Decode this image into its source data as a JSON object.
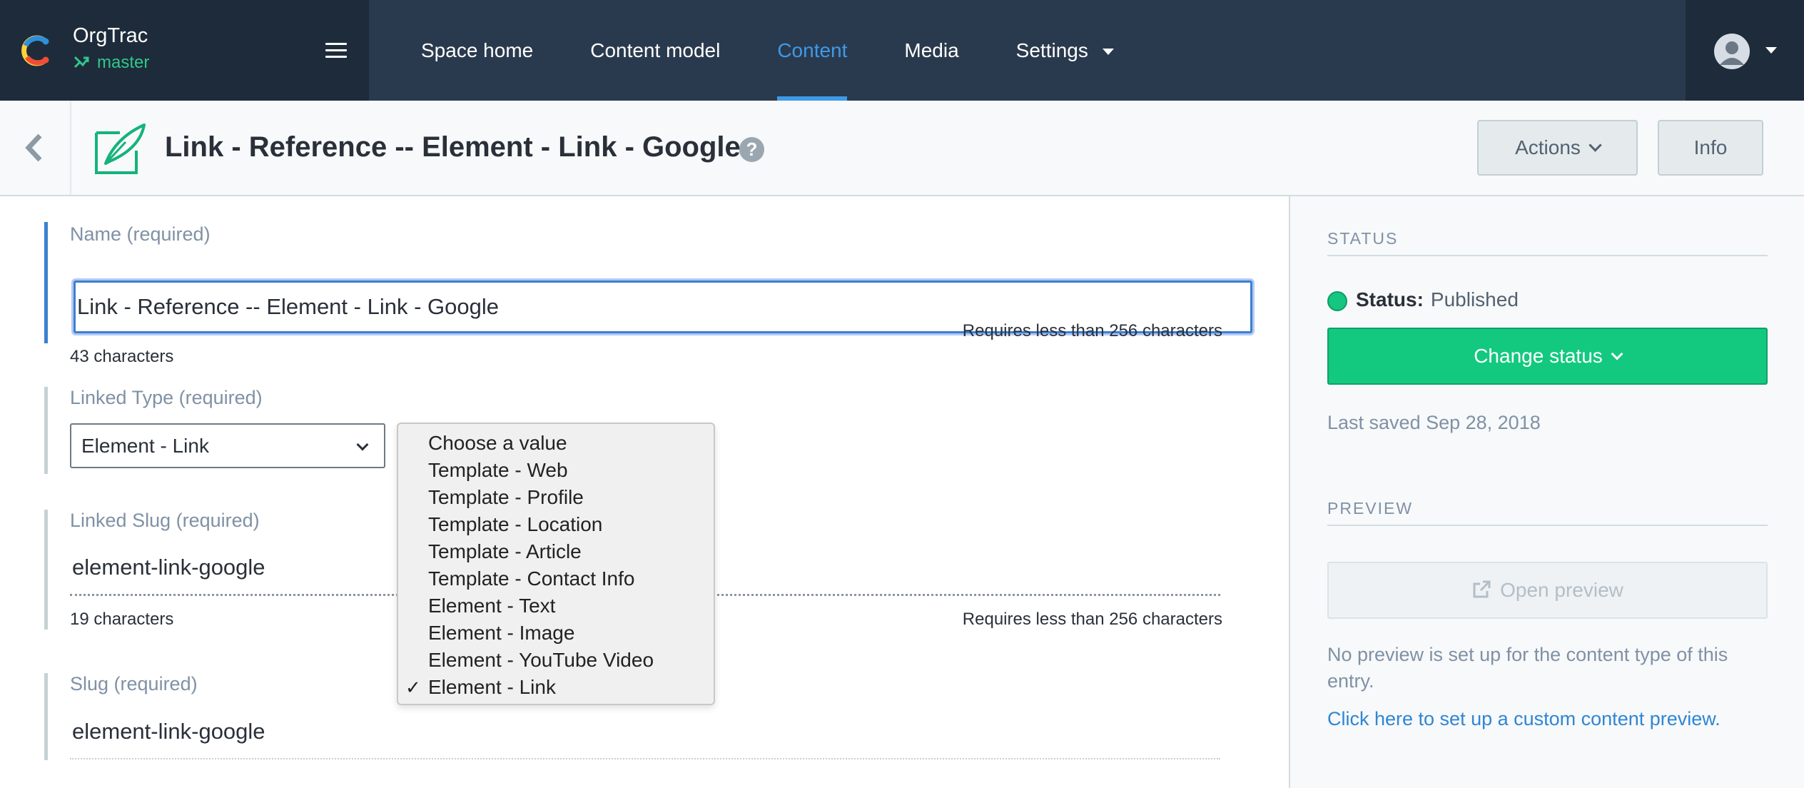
{
  "nav": {
    "space_name": "OrgTrac",
    "environment": "master",
    "items": [
      {
        "label": "Space home"
      },
      {
        "label": "Content model"
      },
      {
        "label": "Content"
      },
      {
        "label": "Media"
      },
      {
        "label": "Settings"
      }
    ],
    "active_item": "Content"
  },
  "entry": {
    "title": "Link - Reference -- Element - Link - Google",
    "help_symbol": "?",
    "actions_label": "Actions",
    "info_label": "Info"
  },
  "fields": {
    "name": {
      "label": "Name (required)",
      "value": "Link - Reference -- Element - Link - Google",
      "count": "43 characters",
      "limit": "Requires less than 256 characters"
    },
    "linked_type": {
      "label": "Linked Type (required)",
      "selected": "Element - Link",
      "options": [
        "Choose a value",
        "Template - Web",
        "Template - Profile",
        "Template - Location",
        "Template - Article",
        "Template - Contact Info",
        "Element - Text",
        "Element - Image",
        "Element - YouTube Video",
        "Element - Link"
      ]
    },
    "linked_slug": {
      "label": "Linked Slug (required)",
      "value": "element-link-google",
      "count": "19 characters",
      "limit": "Requires less than 256 characters"
    },
    "slug": {
      "label": "Slug (required)",
      "value": "element-link-google"
    }
  },
  "sidebar": {
    "status_heading": "STATUS",
    "status_label": "Status:",
    "status_value": "Published",
    "change_status_label": "Change status",
    "last_saved": "Last saved Sep 28, 2018",
    "preview_heading": "PREVIEW",
    "open_preview_label": "Open preview",
    "no_preview_text": "No preview is set up for the content type of this entry.",
    "custom_preview_link": "Click here to set up a custom content preview."
  },
  "colors": {
    "nav_bg": "#2a3a4e",
    "nav_dark": "#1e2b3a",
    "accent_blue": "#3d9ae8",
    "status_green": "#14c67f",
    "link_blue": "#2f86d4"
  },
  "icons": [
    "contentful-logo",
    "branch-icon",
    "hamburger-icon",
    "avatar-icon",
    "back-arrow-icon",
    "entry-feather-icon",
    "help-icon",
    "external-link-icon",
    "check-icon"
  ]
}
